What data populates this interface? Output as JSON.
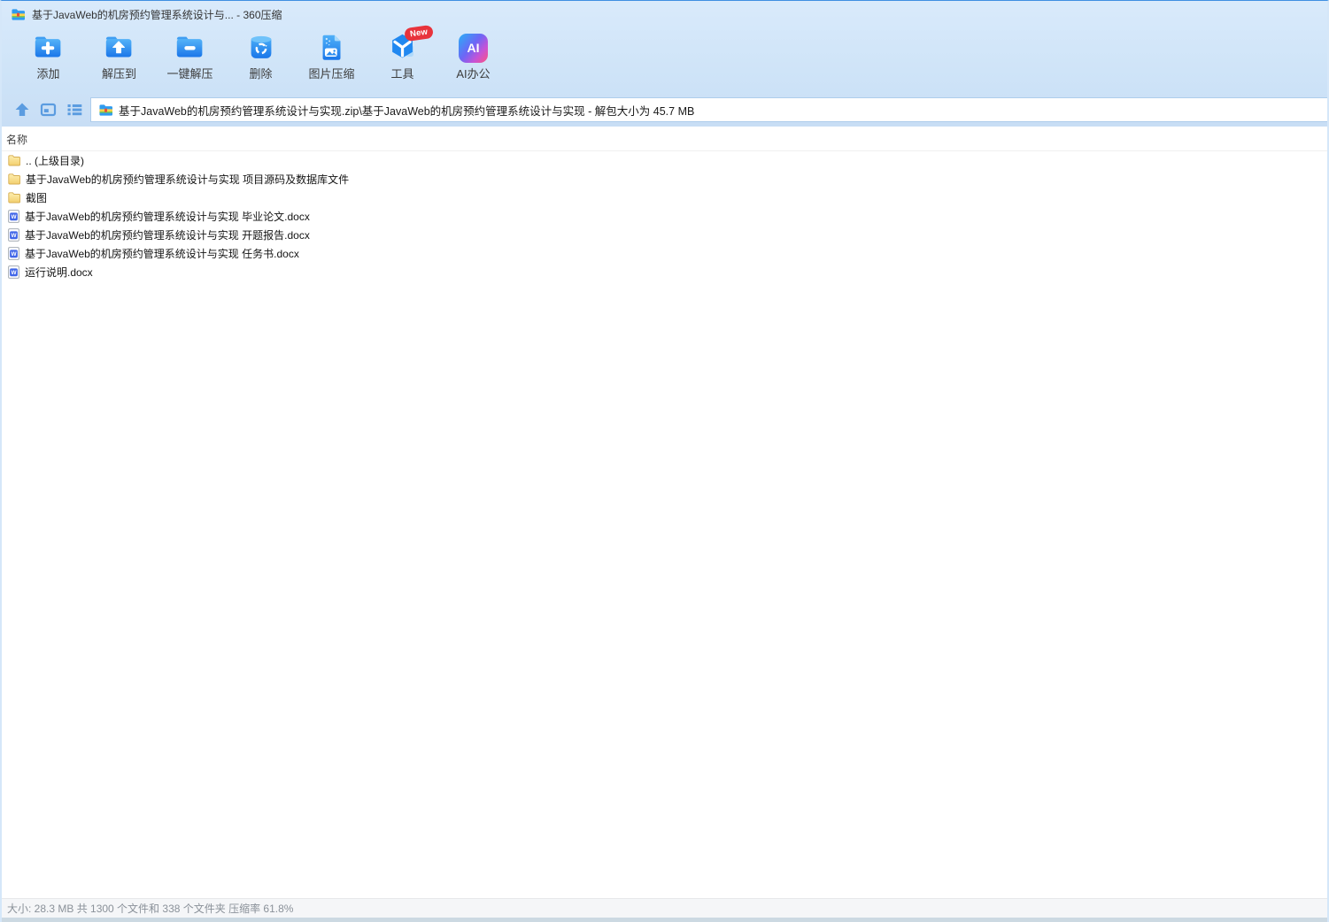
{
  "window": {
    "title": "基于JavaWeb的机房预约管理系统设计与... - 360压缩",
    "app_icon": "archive-file-icon"
  },
  "toolbar": {
    "items": [
      {
        "label": "添加",
        "icon": "add-folder-icon"
      },
      {
        "label": "解压到",
        "icon": "extract-to-folder-icon"
      },
      {
        "label": "一键解压",
        "icon": "one-click-extract-icon"
      },
      {
        "label": "删除",
        "icon": "delete-trash-icon"
      },
      {
        "label": "图片压缩",
        "icon": "image-compress-icon"
      },
      {
        "label": "工具",
        "icon": "tools-cube-icon",
        "badge": "New"
      },
      {
        "label": "AI办公",
        "icon": "ai-office-icon"
      }
    ]
  },
  "addressbar": {
    "nav": [
      {
        "icon": "up-arrow-icon"
      },
      {
        "icon": "view-mode-icon"
      },
      {
        "icon": "list-view-icon"
      }
    ],
    "path_icon": "archive-file-icon",
    "path": "基于JavaWeb的机房预约管理系统设计与实现.zip\\基于JavaWeb的机房预约管理系统设计与实现 - 解包大小为 45.7 MB"
  },
  "filelist": {
    "name_header": "名称",
    "rows": [
      {
        "name": ".. (上级目录)",
        "icon": "folder-icon"
      },
      {
        "name": "基于JavaWeb的机房预约管理系统设计与实现 项目源码及数据库文件",
        "icon": "folder-icon"
      },
      {
        "name": "截图",
        "icon": "folder-icon"
      },
      {
        "name": "基于JavaWeb的机房预约管理系统设计与实现 毕业论文.docx",
        "icon": "word-doc-icon"
      },
      {
        "name": "基于JavaWeb的机房预约管理系统设计与实现 开题报告.docx",
        "icon": "word-doc-icon"
      },
      {
        "name": "基于JavaWeb的机房预约管理系统设计与实现 任务书.docx",
        "icon": "word-doc-icon"
      },
      {
        "name": "运行说明.docx",
        "icon": "word-doc-icon"
      }
    ]
  },
  "statusbar": {
    "text": "大小: 28.3 MB 共 1300 个文件和 338 个文件夹 压缩率 61.8%"
  },
  "icons": {
    "ai_text": "AI",
    "word_letter": "W"
  },
  "colors": {
    "chrome_blue": "#cfe4f8",
    "accent_blue": "#1f7ce8",
    "nav_icon_blue": "#5b9ce0",
    "badge_red": "#e8333c",
    "folder_yellow": "#f5d878",
    "word_blue": "#4166e8"
  }
}
